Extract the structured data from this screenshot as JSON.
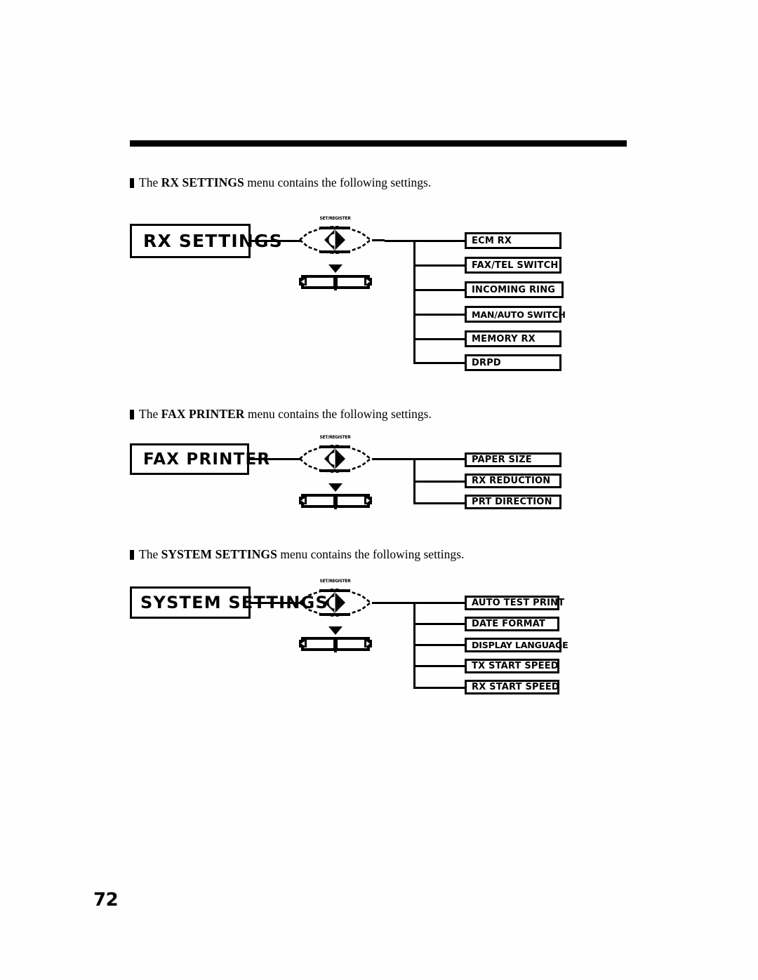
{
  "page": {
    "number": "72",
    "rule_color": "#000000"
  },
  "sections": [
    {
      "id": "rx-settings",
      "intro": {
        "prefix": "The ",
        "menu_name": "RX SETTINGS",
        "suffix": " menu contains the  following settings."
      },
      "root": {
        "label": "RX SETTINGS",
        "font_size": "25px"
      },
      "button_graphic": {
        "micro_label": "SET/REGISTER",
        "set_button_name": "set-button-icon",
        "arrow_keys_name": "arrow-keys-icon"
      },
      "items": [
        {
          "label": "ECM RX",
          "tight": false
        },
        {
          "label": "FAX/TEL SWITCH",
          "tight": false
        },
        {
          "label": "INCOMING RING",
          "tight": false
        },
        {
          "label": "MAN/AUTO SWITCH",
          "tight": true
        },
        {
          "label": "MEMORY RX",
          "tight": false
        },
        {
          "label": "DRPD",
          "tight": false
        }
      ]
    },
    {
      "id": "fax-printer",
      "intro": {
        "prefix": "The ",
        "menu_name": "FAX PRINTER",
        "suffix": " menu contains the  following settings."
      },
      "root": {
        "label": "FAX PRINTER",
        "font_size": "23px"
      },
      "button_graphic": {
        "micro_label": "SET/REGISTER",
        "set_button_name": "set-button-icon",
        "arrow_keys_name": "arrow-keys-icon"
      },
      "items": [
        {
          "label": "PAPER SIZE",
          "tight": false
        },
        {
          "label": "RX REDUCTION",
          "tight": false
        },
        {
          "label": "PRT DIRECTION",
          "tight": false
        }
      ]
    },
    {
      "id": "system-settings",
      "intro": {
        "prefix": "The ",
        "menu_name": "SYSTEM SETTINGS",
        "suffix": " menu contains the  following settings."
      },
      "root": {
        "label": "SYSTEM SETTINGS",
        "font_size": "24px"
      },
      "button_graphic": {
        "micro_label": "SET/REGISTER",
        "set_button_name": "set-button-icon",
        "arrow_keys_name": "arrow-keys-icon"
      },
      "items": [
        {
          "label": "AUTO TEST PRINT",
          "tight": false
        },
        {
          "label": "DATE FORMAT",
          "tight": false
        },
        {
          "label": "DISPLAY LANGUAGE",
          "tight": true
        },
        {
          "label": "TX START SPEED",
          "tight": false
        },
        {
          "label": "RX START SPEED",
          "tight": false
        }
      ]
    }
  ]
}
